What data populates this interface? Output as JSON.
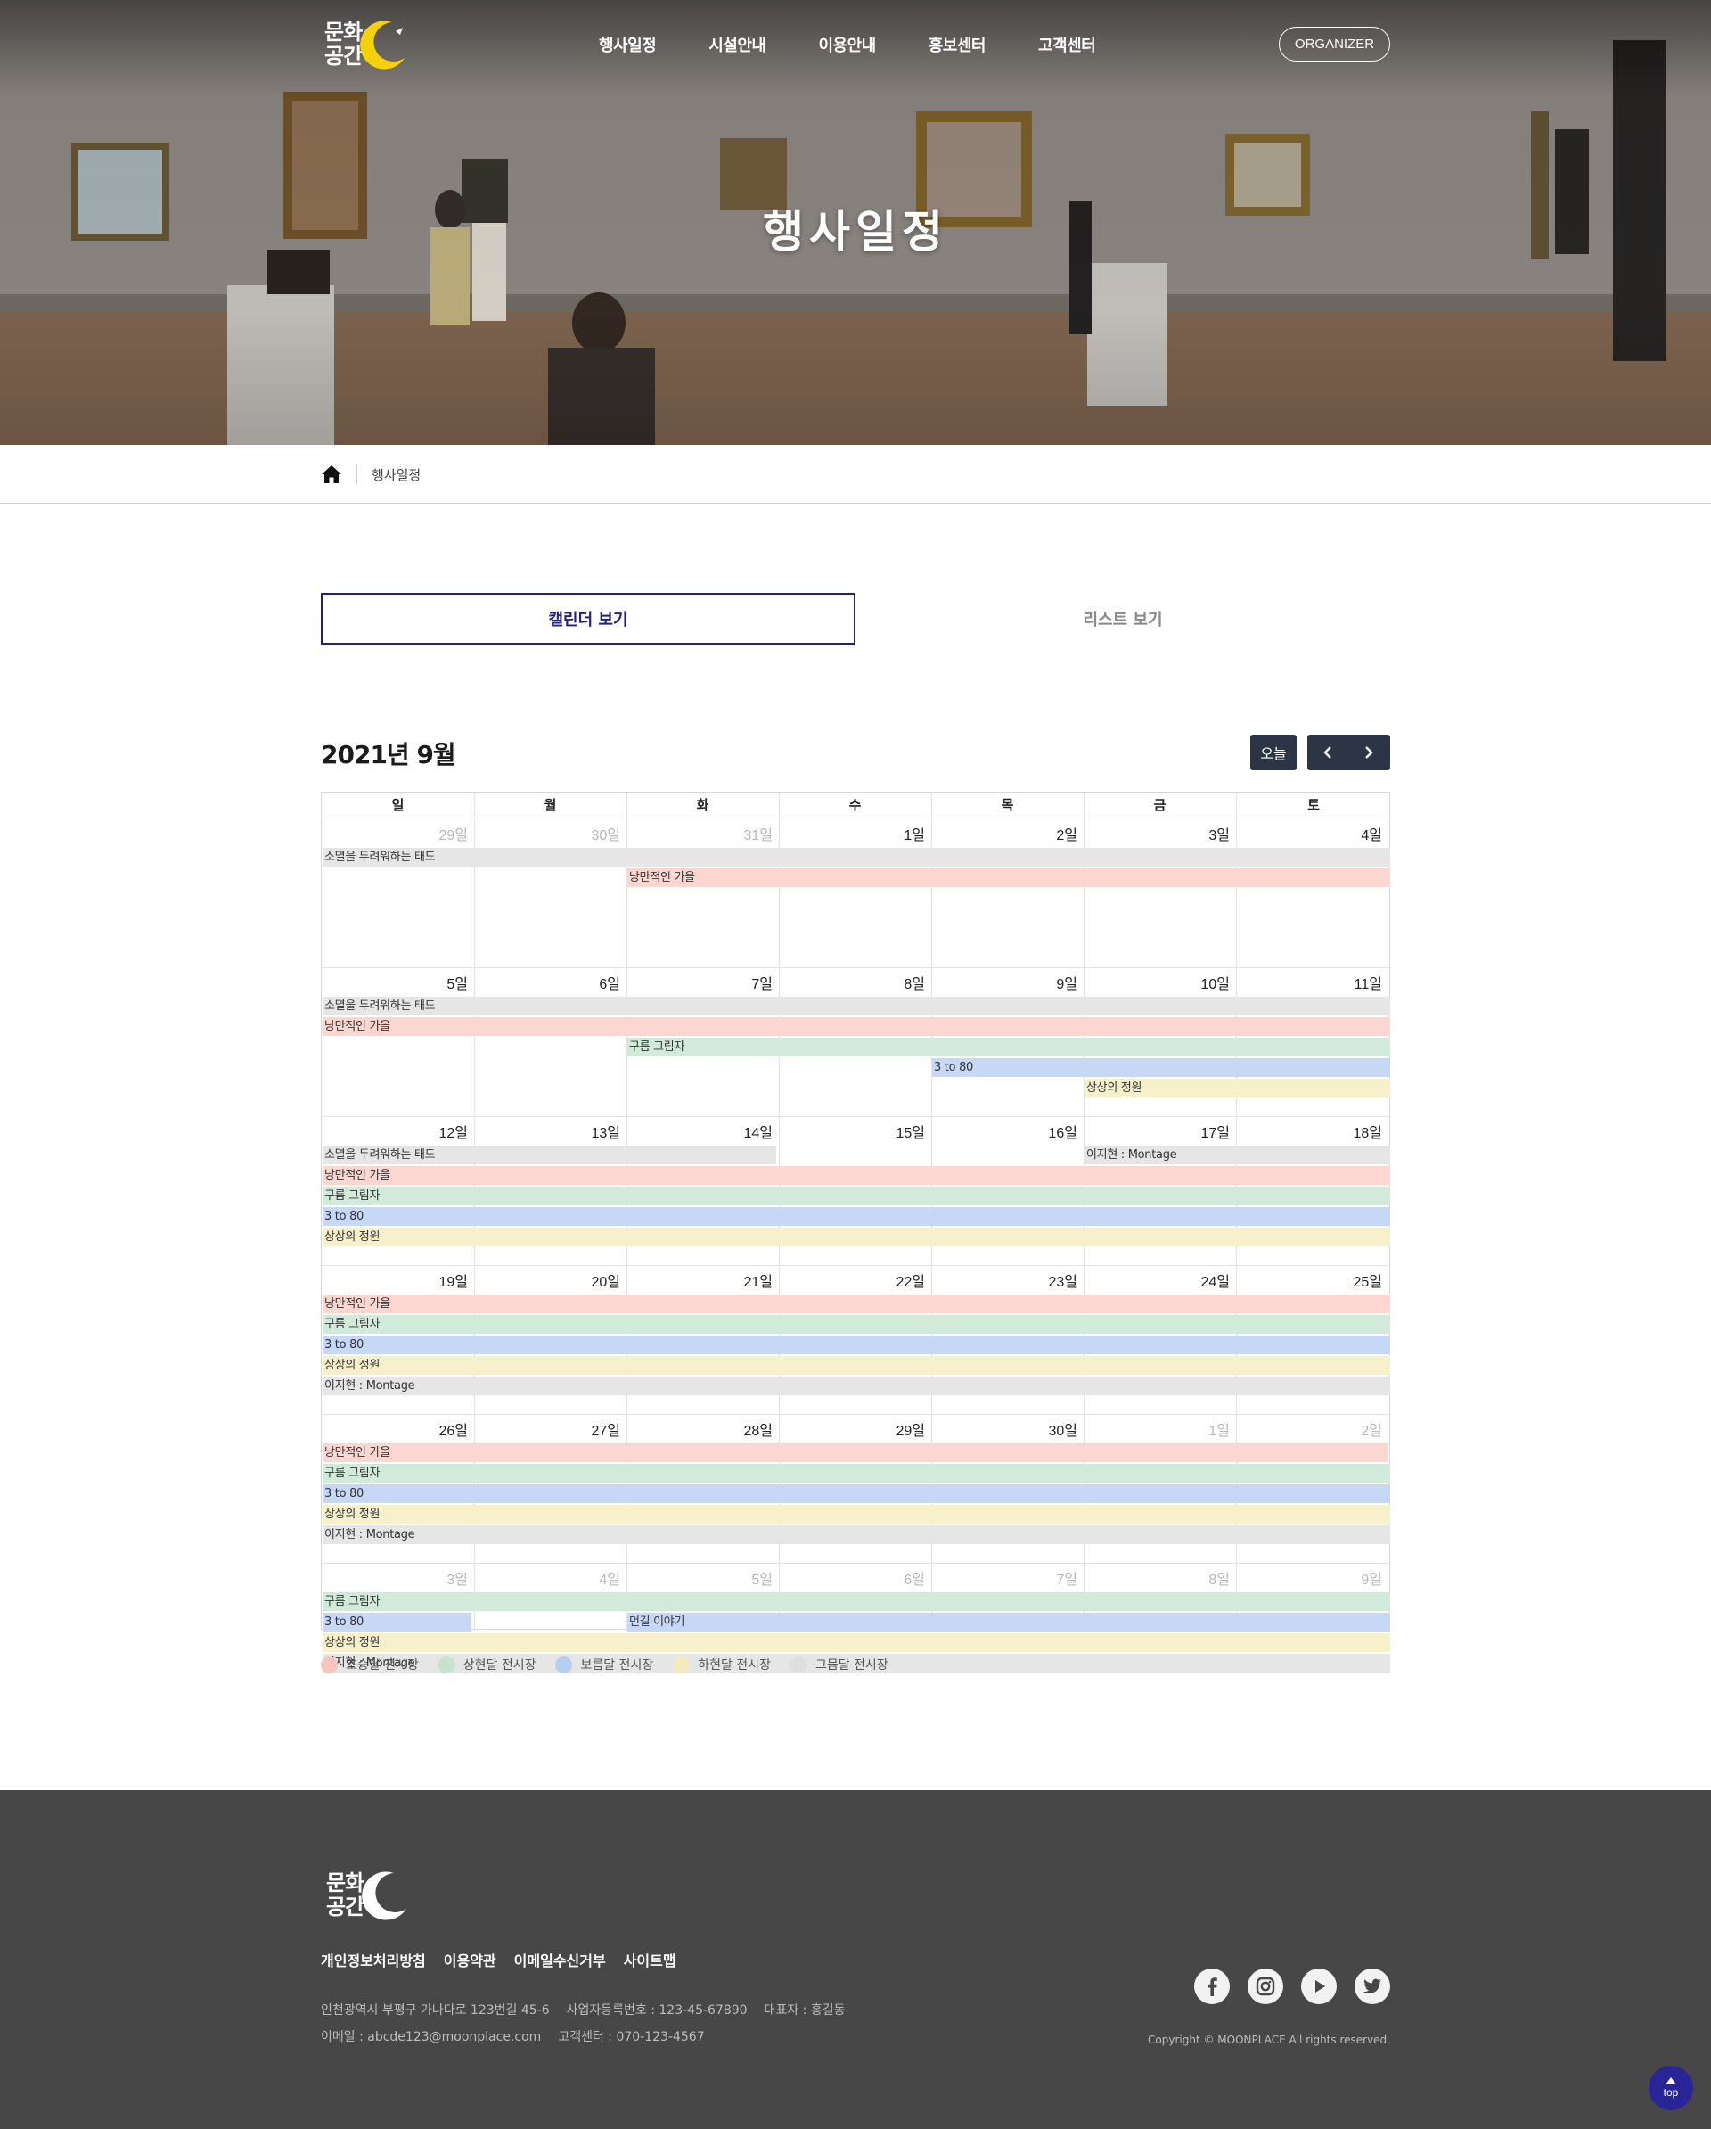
{
  "header": {
    "logo_text_line1": "문화",
    "logo_text_line2": "공간",
    "nav": [
      "행사일정",
      "시설안내",
      "이용안내",
      "홍보센터",
      "고객센터"
    ],
    "organizer_label": "ORGANIZER",
    "hero_title": "행사일정"
  },
  "breadcrumb": {
    "home_icon": "home-icon",
    "current": "행사일정"
  },
  "tabs": {
    "calendar_label": "캘린더 보기",
    "list_label": "리스트 보기",
    "active": "calendar"
  },
  "calendar": {
    "title": "2021년 9월",
    "today_label": "오늘",
    "prev_icon": "chevron-left-icon",
    "next_icon": "chevron-right-icon",
    "weekdays": [
      "일",
      "월",
      "화",
      "수",
      "목",
      "금",
      "토"
    ],
    "weeks": [
      {
        "days": [
          {
            "label": "29일",
            "other": true
          },
          {
            "label": "30일",
            "other": true
          },
          {
            "label": "31일",
            "other": true
          },
          {
            "label": "1일"
          },
          {
            "label": "2일"
          },
          {
            "label": "3일"
          },
          {
            "label": "4일"
          }
        ],
        "events": [
          {
            "title": "소멸을 두려워하는 태도",
            "start": 0,
            "end": 6,
            "row": 0,
            "color": "gray",
            "show_title": true
          },
          {
            "title": "낭만적인 가을",
            "start": 2,
            "end": 6,
            "row": 1,
            "color": "pink",
            "show_title": true
          }
        ]
      },
      {
        "days": [
          {
            "label": "5일"
          },
          {
            "label": "6일"
          },
          {
            "label": "7일"
          },
          {
            "label": "8일"
          },
          {
            "label": "9일"
          },
          {
            "label": "10일"
          },
          {
            "label": "11일"
          }
        ],
        "events": [
          {
            "title": "소멸을 두려워하는 태도",
            "start": 0,
            "end": 6,
            "row": 0,
            "color": "gray",
            "show_title": true
          },
          {
            "title": "낭만적인 가을",
            "start": 0,
            "end": 6,
            "row": 1,
            "color": "pink",
            "show_title": true
          },
          {
            "title": "구름 그림자",
            "start": 2,
            "end": 6,
            "row": 2,
            "color": "green",
            "show_title": true
          },
          {
            "title": "3 to 80",
            "start": 4,
            "end": 6,
            "row": 3,
            "color": "blue",
            "show_title": true
          },
          {
            "title": "상상의 정원",
            "start": 5,
            "end": 6,
            "row": 4,
            "color": "yellow",
            "show_title": true
          }
        ]
      },
      {
        "days": [
          {
            "label": "12일"
          },
          {
            "label": "13일"
          },
          {
            "label": "14일"
          },
          {
            "label": "15일"
          },
          {
            "label": "16일"
          },
          {
            "label": "17일"
          },
          {
            "label": "18일"
          }
        ],
        "events": [
          {
            "title": "소멸을 두려워하는 태도",
            "start": 0,
            "end": 2,
            "row": 0,
            "color": "gray",
            "show_title": true,
            "cut_end": true
          },
          {
            "title": "이지현 : Montage",
            "start": 5,
            "end": 6,
            "row": 0,
            "color": "gray",
            "show_title": true
          },
          {
            "title": "낭만적인 가을",
            "start": 0,
            "end": 6,
            "row": 1,
            "color": "pink",
            "show_title": true
          },
          {
            "title": "구름 그림자",
            "start": 0,
            "end": 6,
            "row": 2,
            "color": "green",
            "show_title": true
          },
          {
            "title": "3 to 80",
            "start": 0,
            "end": 6,
            "row": 3,
            "color": "blue",
            "show_title": true
          },
          {
            "title": "상상의 정원",
            "start": 0,
            "end": 6,
            "row": 4,
            "color": "yellow",
            "show_title": true
          }
        ]
      },
      {
        "days": [
          {
            "label": "19일"
          },
          {
            "label": "20일"
          },
          {
            "label": "21일"
          },
          {
            "label": "22일"
          },
          {
            "label": "23일"
          },
          {
            "label": "24일"
          },
          {
            "label": "25일"
          }
        ],
        "events": [
          {
            "title": "낭만적인 가을",
            "start": 0,
            "end": 6,
            "row": 0,
            "color": "pink",
            "show_title": true
          },
          {
            "title": "구름 그림자",
            "start": 0,
            "end": 6,
            "row": 1,
            "color": "green",
            "show_title": true
          },
          {
            "title": "3 to 80",
            "start": 0,
            "end": 6,
            "row": 2,
            "color": "blue",
            "show_title": true
          },
          {
            "title": "상상의 정원",
            "start": 0,
            "end": 6,
            "row": 3,
            "color": "yellow",
            "show_title": true
          },
          {
            "title": "이지현 : Montage",
            "start": 0,
            "end": 6,
            "row": 4,
            "color": "gray",
            "show_title": true
          }
        ]
      },
      {
        "days": [
          {
            "label": "26일"
          },
          {
            "label": "27일"
          },
          {
            "label": "28일"
          },
          {
            "label": "29일"
          },
          {
            "label": "30일"
          },
          {
            "label": "1일",
            "other": true
          },
          {
            "label": "2일",
            "other": true
          }
        ],
        "events": [
          {
            "title": "낭만적인 가을",
            "start": 0,
            "end": 6,
            "row": 0,
            "color": "pink",
            "show_title": true,
            "cut_end": true
          },
          {
            "title": "구름 그림자",
            "start": 0,
            "end": 6,
            "row": 1,
            "color": "green",
            "show_title": true
          },
          {
            "title": "3 to 80",
            "start": 0,
            "end": 6,
            "row": 2,
            "color": "blue",
            "show_title": true
          },
          {
            "title": "상상의 정원",
            "start": 0,
            "end": 6,
            "row": 3,
            "color": "yellow",
            "show_title": true
          },
          {
            "title": "이지현 : Montage",
            "start": 0,
            "end": 6,
            "row": 4,
            "color": "gray",
            "show_title": true
          }
        ]
      },
      {
        "days": [
          {
            "label": "3일",
            "other": true
          },
          {
            "label": "4일",
            "other": true
          },
          {
            "label": "5일",
            "other": true
          },
          {
            "label": "6일",
            "other": true
          },
          {
            "label": "7일",
            "other": true
          },
          {
            "label": "8일",
            "other": true
          },
          {
            "label": "9일",
            "other": true
          }
        ],
        "events": [
          {
            "title": "구름 그림자",
            "start": 0,
            "end": 6,
            "row": 0,
            "color": "green",
            "show_title": true
          },
          {
            "title": "3 to 80",
            "start": 0,
            "end": 0,
            "row": 1,
            "color": "blue",
            "show_title": true,
            "cut_end": true
          },
          {
            "title": "먼길 이야기",
            "start": 2,
            "end": 6,
            "row": 1,
            "color": "blue",
            "show_title": true
          },
          {
            "title": "상상의 정원",
            "start": 0,
            "end": 6,
            "row": 2,
            "color": "yellow",
            "show_title": true
          },
          {
            "title": "이지현 : Montage",
            "start": 0,
            "end": 6,
            "row": 3,
            "color": "gray",
            "show_title": true
          }
        ]
      }
    ]
  },
  "legend": [
    {
      "label": "초승달 전시장",
      "color": "#f8c4be"
    },
    {
      "label": "상현달 전시장",
      "color": "#c7e3cf"
    },
    {
      "label": "보름달 전시장",
      "color": "#b8cdf2"
    },
    {
      "label": "하현달 전시장",
      "color": "#f3ebbd"
    },
    {
      "label": "그믐달 전시장",
      "color": "#dedede"
    }
  ],
  "event_colors": {
    "pink": "#fcd6d0",
    "green": "#d2eada",
    "blue": "#c7d8f6",
    "yellow": "#f6f0cb",
    "gray": "#e6e6e6"
  },
  "footer": {
    "links": [
      "개인정보처리방침",
      "이용약관",
      "이메일수신거부",
      "사이트맵"
    ],
    "address": "인천광역시 부평구 가나다로 123번길 45-6",
    "business_no": "사업자등록번호 : 123-45-67890",
    "ceo": "대표자 : 홍길동",
    "email": "이메일 : abcde123@moonplace.com",
    "phone": "고객센터 : 070-123-4567",
    "copyright": "Copyright © MOONPLACE All rights reserved.",
    "social": [
      "facebook-icon",
      "instagram-icon",
      "youtube-icon",
      "twitter-icon"
    ],
    "top_label": "top"
  },
  "colors": {
    "accent": "#23207e",
    "dark_button": "#2c3546",
    "footer_bg": "#474747",
    "logo_moon": "#f5d10c"
  }
}
